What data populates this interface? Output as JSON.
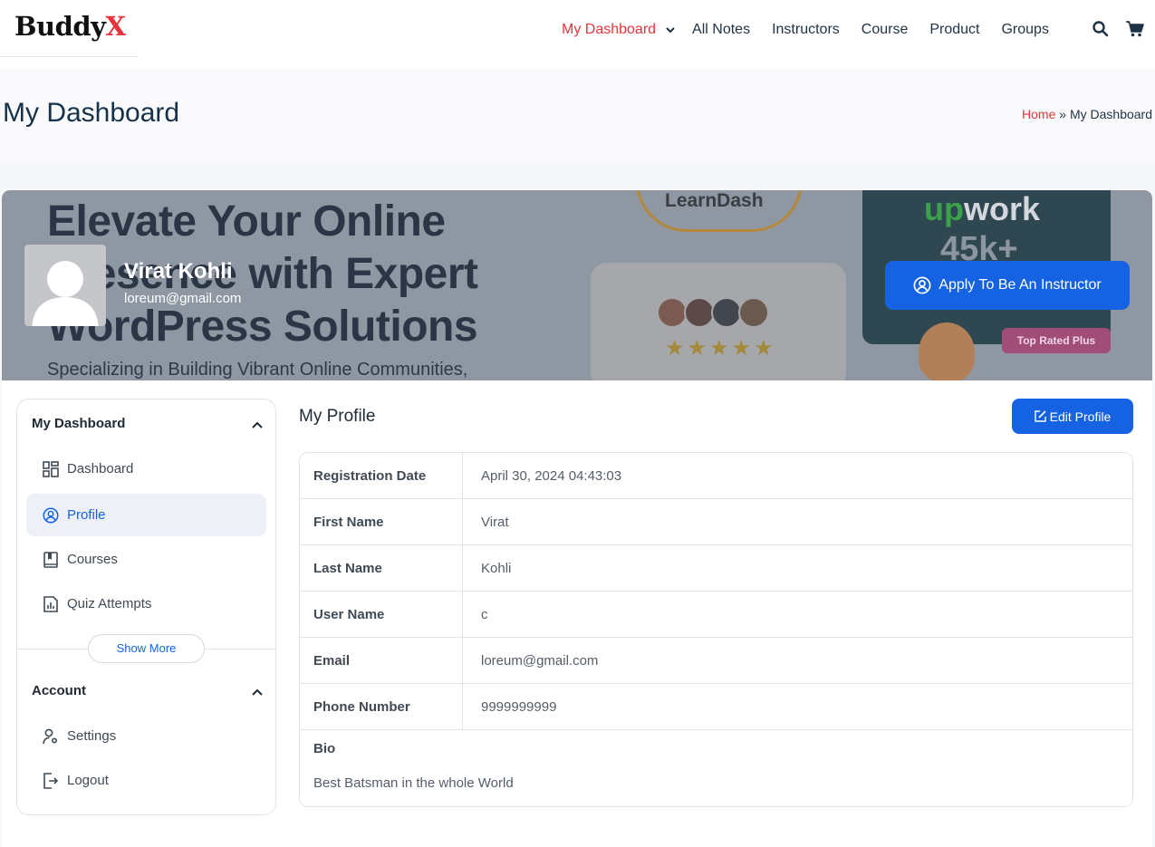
{
  "brand": {
    "logo_main": "Buddy",
    "logo_x": "X"
  },
  "nav": {
    "items": [
      {
        "label": "My Dashboard",
        "active": true,
        "has_dropdown": true
      },
      {
        "label": "All Notes"
      },
      {
        "label": "Instructors"
      },
      {
        "label": "Course"
      },
      {
        "label": "Product"
      },
      {
        "label": "Groups"
      }
    ],
    "icons": [
      "search-icon",
      "cart-icon"
    ]
  },
  "title_bar": {
    "title": "My Dashboard",
    "breadcrumb": {
      "home": "Home",
      "separator": "»",
      "current": "My Dashboard"
    }
  },
  "banner": {
    "headline": "Elevate Your Online Presence with Expert WordPress Solutions",
    "subline": "Specializing in Building Vibrant Online Communities,",
    "learndash_logo": "LearnDash",
    "rating_stars": "★★★★★",
    "upwork_logo_a": "up",
    "upwork_logo_b": "work",
    "upwork_stat": "45k+",
    "upwork_badge": "Top Rated Plus"
  },
  "profile_header": {
    "name": "Virat Kohli",
    "email": "loreum@gmail.com",
    "apply_label": "Apply To Be An Instructor"
  },
  "sidebar": {
    "sections": [
      {
        "title": "My Dashboard",
        "items": [
          {
            "label": "Dashboard",
            "icon": "dashboard-icon"
          },
          {
            "label": "Profile",
            "icon": "profile-icon",
            "active": true
          },
          {
            "label": "Courses",
            "icon": "book-icon"
          },
          {
            "label": "Quiz Attempts",
            "icon": "quiz-icon"
          }
        ]
      },
      {
        "title": "Account",
        "items": [
          {
            "label": "Settings",
            "icon": "settings-user-icon"
          },
          {
            "label": "Logout",
            "icon": "logout-icon"
          }
        ]
      }
    ],
    "show_more_label": "Show More"
  },
  "profile": {
    "title": "My Profile",
    "edit_label": "Edit Profile",
    "rows": [
      {
        "label": "Registration Date",
        "value": "April 30, 2024 04:43:03"
      },
      {
        "label": "First Name",
        "value": "Virat"
      },
      {
        "label": "Last Name",
        "value": "Kohli"
      },
      {
        "label": "User Name",
        "value": "c"
      },
      {
        "label": "Email",
        "value": "loreum@gmail.com"
      },
      {
        "label": "Phone Number",
        "value": "9999999999"
      }
    ],
    "bio_label": "Bio",
    "bio_value": "Best Batsman in the whole World"
  },
  "colors": {
    "accent": "#1563e3",
    "brand_red": "#e8343a",
    "text_dark": "#16324a"
  }
}
